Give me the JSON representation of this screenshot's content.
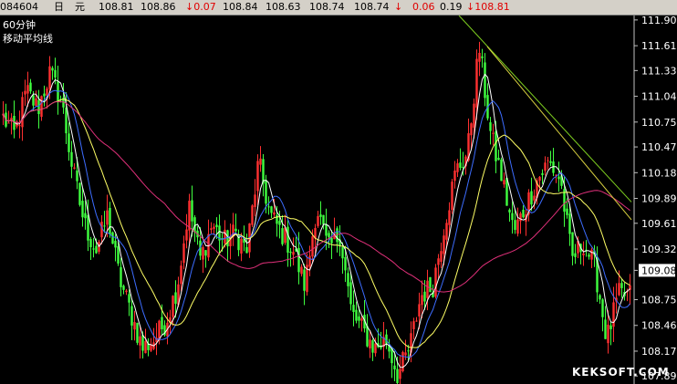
{
  "quote_bar": {
    "code": "084604",
    "period": "日",
    "unit": "元",
    "open": "108.81",
    "high": "108.86",
    "change": "↓0.07",
    "low": "108.84",
    "v1": "108.63",
    "v2": "108.74",
    "v3": "108.74",
    "arrow": "↓",
    "change2": "0.06",
    "v4": "0.19",
    "last": "↓108.81"
  },
  "chart_labels": {
    "interval": "60分钟",
    "indicator": "移动平均线"
  },
  "watermark": "KEKSOFT.COM",
  "colors": {
    "background": "#000000",
    "candle_up": "#ff3030",
    "candle_down": "#40ff40",
    "ma_short": "#ffffff",
    "ma_blue": "#3d6dff",
    "ma_yellow": "#ffff66",
    "ma_long": "#e0307a",
    "trendline": "#7fd020",
    "current_price_box": "#ffffff"
  },
  "chart_data": {
    "type": "candlestick",
    "ylim": [
      107.8,
      111.95
    ],
    "y_ticks": [
      "111.90",
      "111.61",
      "111.33",
      "111.04",
      "110.75",
      "110.47",
      "110.18",
      "109.89",
      "109.61",
      "109.32",
      "109.08",
      "108.75",
      "108.46",
      "108.17",
      "107.89"
    ],
    "current_price": "109.08",
    "price_path": [
      110.8,
      110.6,
      111.1,
      110.9,
      111.3,
      111.0,
      110.2,
      109.6,
      109.3,
      109.7,
      109.0,
      108.6,
      108.2,
      108.3,
      108.5,
      108.9,
      109.8,
      109.2,
      109.6,
      109.4,
      109.5,
      109.3,
      110.3,
      109.7,
      109.5,
      109.3,
      108.9,
      109.8,
      109.3,
      109.5,
      108.6,
      108.4,
      108.2,
      108.3,
      107.9,
      108.2,
      108.8,
      108.9,
      109.6,
      110.2,
      110.4,
      111.6,
      110.6,
      110.1,
      109.5,
      109.8,
      110.1,
      110.3,
      110.1,
      109.2,
      109.4,
      109.1,
      108.3,
      108.8,
      108.8
    ]
  }
}
